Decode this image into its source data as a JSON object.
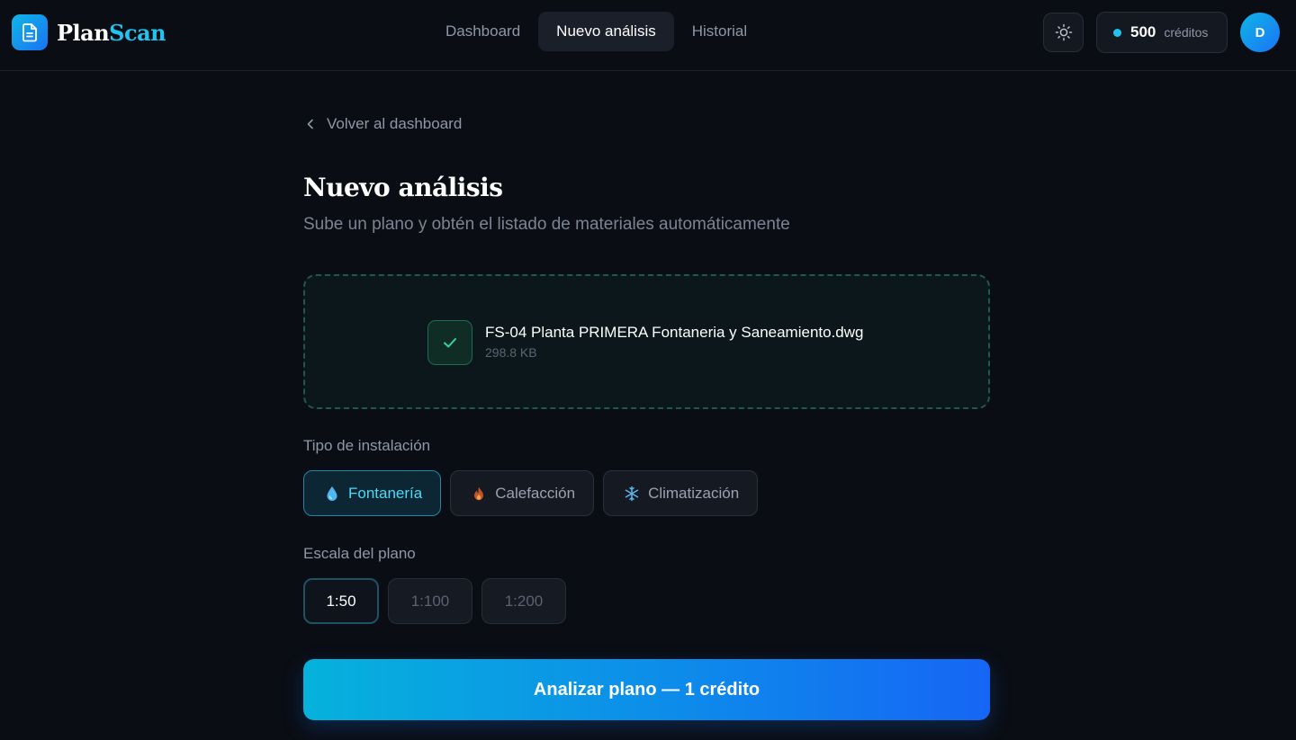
{
  "brand": {
    "name_part1": "Plan",
    "name_part2": "Scan"
  },
  "nav": {
    "items": [
      {
        "label": "Dashboard",
        "active": false
      },
      {
        "label": "Nuevo análisis",
        "active": true
      },
      {
        "label": "Historial",
        "active": false
      }
    ]
  },
  "header": {
    "theme_icon": "sun-icon",
    "credits": {
      "amount": "500",
      "label": "créditos"
    },
    "avatar_initial": "D"
  },
  "page": {
    "back_label": "Volver al dashboard",
    "title": "Nuevo análisis",
    "subtitle": "Sube un plano y obtén el listado de materiales automáticamente"
  },
  "upload": {
    "file_name": "FS-04 Planta PRIMERA Fontaneria y Saneamiento.dwg",
    "file_size": "298.8 KB",
    "status_icon": "check-icon"
  },
  "installation": {
    "label": "Tipo de instalación",
    "options": [
      {
        "label": "Fontanería",
        "icon": "water-drop-icon",
        "selected": true
      },
      {
        "label": "Calefacción",
        "icon": "flame-icon",
        "selected": false
      },
      {
        "label": "Climatización",
        "icon": "snowflake-icon",
        "selected": false
      }
    ]
  },
  "scale": {
    "label": "Escala del plano",
    "options": [
      {
        "label": "1:50",
        "selected": true
      },
      {
        "label": "1:100",
        "selected": false
      },
      {
        "label": "1:200",
        "selected": false
      }
    ]
  },
  "submit": {
    "label": "Analizar plano — 1 crédito"
  },
  "colors": {
    "accent": "#22c3ee",
    "background": "#0a0d14",
    "success": "#1f6b54",
    "button_gradient_start": "#06b2dc",
    "button_gradient_end": "#1666f5"
  }
}
